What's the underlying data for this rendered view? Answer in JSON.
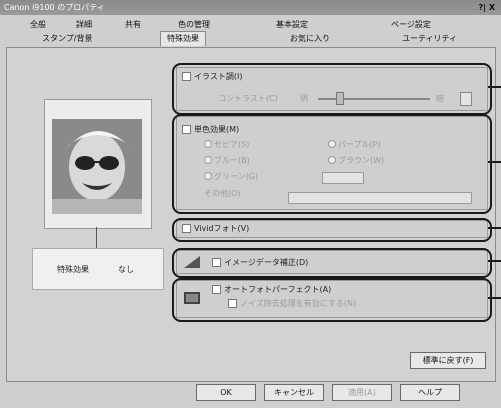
{
  "window": {
    "title": "Canon i9100 のプロパティ",
    "title_controls": "?| X"
  },
  "tabs_top": [
    {
      "label": "全般"
    },
    {
      "label": "詳細"
    },
    {
      "label": "共有"
    },
    {
      "label": "色の管理"
    },
    {
      "label": "基本設定"
    },
    {
      "label": "ページ設定"
    }
  ],
  "tabs_bottom": [
    {
      "label": "スタンプ/背景"
    },
    {
      "label": "特殊効果"
    },
    {
      "label": "お気に入り"
    },
    {
      "label": "ユーティリティ"
    }
  ],
  "preview": {
    "status_label": "特殊効果",
    "status_value": "なし"
  },
  "groups": {
    "illustration": {
      "checkbox_label": "イラスト調(I)",
      "contrast_label": "コントラスト(C)",
      "slider_left": "明",
      "slider_right": "暗"
    },
    "monochrome": {
      "checkbox_label": "単色効果(M)",
      "radios_left": [
        "セピア(S)",
        "ブルー(B)",
        "グリーン(G)"
      ],
      "radios_right": [
        "パープル(P)",
        "ブラウン(W)"
      ],
      "select_label": "その他(O)"
    },
    "vivid": {
      "checkbox_label": "Vividフォト(V)"
    },
    "image_data": {
      "checkbox_label": "イメージデータ補正(D)"
    },
    "auto_photo": {
      "checkbox_label": "オートフォトパーフェクト(A)",
      "sub_checkbox_label": "ノイズ除去処理を有効にする(N)"
    }
  },
  "buttons": {
    "standard": "標準に戻す(F)",
    "ok": "OK",
    "cancel": "キャンセル",
    "apply": "適用(A)",
    "help": "ヘルプ"
  },
  "colors": {
    "callout_border": "#1a1a1a",
    "panel_bg": "#d2d2d2",
    "disabled_text": "#9a9a9a"
  }
}
